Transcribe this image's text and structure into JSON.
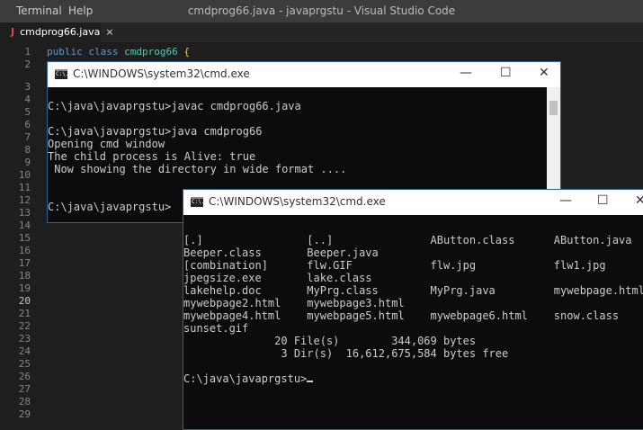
{
  "menubar": {
    "items": [
      "Terminal",
      "Help"
    ],
    "title": "cmdprog66.java - javaprgstu - Visual Studio Code"
  },
  "tab": {
    "icon": "J",
    "label": "cmdprog66.java",
    "close": "×"
  },
  "editor": {
    "line_numbers": [
      "1",
      "2",
      "3",
      "4",
      "5",
      "6",
      "7",
      "8",
      "9",
      "10",
      "11",
      "12",
      "13",
      "14",
      "15",
      "16",
      "17",
      "18",
      "19",
      "20",
      "21",
      "22",
      "23",
      "24",
      "25",
      "26",
      "27",
      "28",
      "29"
    ],
    "code": {
      "kw1": "public",
      "kw2": "class",
      "cls": "cmdprog66",
      "brace": "{"
    }
  },
  "cmd1": {
    "title": "C:\\WINDOWS\\system32\\cmd.exe",
    "icon_text": "C:\\.",
    "lines": [
      "",
      "C:\\java\\javaprgstu>javac cmdprog66.java",
      "",
      "C:\\java\\javaprgstu>java cmdprog66",
      "Opening cmd window",
      "The child process is Alive: true",
      " Now showing the directory in wide format ....",
      "",
      "",
      "C:\\java\\javaprgstu>"
    ]
  },
  "cmd2": {
    "title": "C:\\WINDOWS\\system32\\cmd.exe",
    "icon_text": "C:\\.",
    "lines": [
      "",
      "[.]                [..]               AButton.class      AButton.java",
      "Beeper.class       Beeper.java",
      "[combination]      flw.GIF            flw.jpg            flw1.jpg",
      "jpegsize.exe       lake.class",
      "lakehelp.doc       MyPrg.class        MyPrg.java         mywebpage.html",
      "mywebpage2.html    mywebpage3.html",
      "mywebpage4.html    mywebpage5.html    mywebpage6.html    snow.class",
      "sunset.gif",
      "              20 File(s)        344,069 bytes",
      "               3 Dir(s)  16,612,675,584 bytes free",
      ""
    ],
    "prompt": "C:\\java\\javaprgstu>"
  },
  "controls": {
    "minimize": "—",
    "maximize": "☐",
    "close": "✕"
  }
}
